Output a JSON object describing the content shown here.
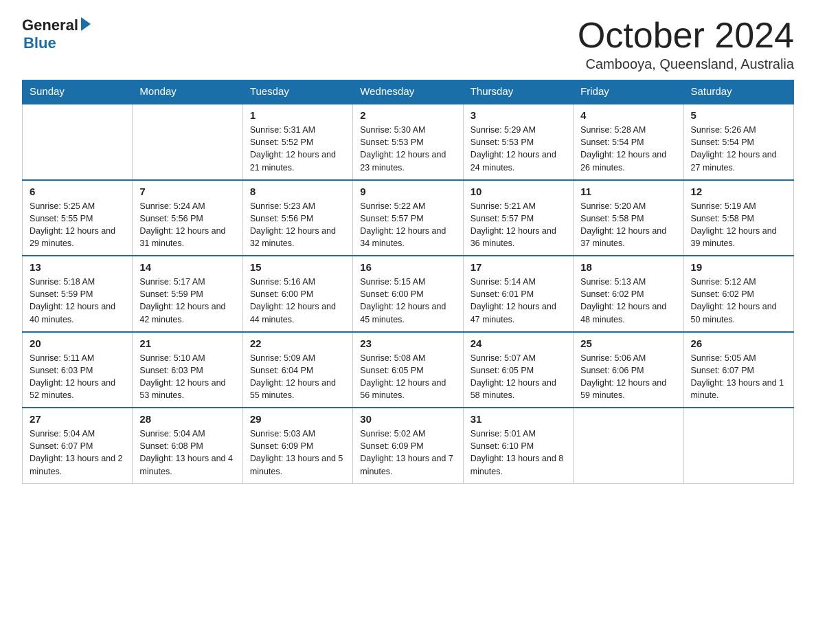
{
  "header": {
    "logo_general": "General",
    "logo_blue": "Blue",
    "title": "October 2024",
    "location": "Cambooya, Queensland, Australia"
  },
  "weekdays": [
    "Sunday",
    "Monday",
    "Tuesday",
    "Wednesday",
    "Thursday",
    "Friday",
    "Saturday"
  ],
  "weeks": [
    [
      null,
      null,
      {
        "day": 1,
        "sunrise": "5:31 AM",
        "sunset": "5:52 PM",
        "daylight": "12 hours and 21 minutes."
      },
      {
        "day": 2,
        "sunrise": "5:30 AM",
        "sunset": "5:53 PM",
        "daylight": "12 hours and 23 minutes."
      },
      {
        "day": 3,
        "sunrise": "5:29 AM",
        "sunset": "5:53 PM",
        "daylight": "12 hours and 24 minutes."
      },
      {
        "day": 4,
        "sunrise": "5:28 AM",
        "sunset": "5:54 PM",
        "daylight": "12 hours and 26 minutes."
      },
      {
        "day": 5,
        "sunrise": "5:26 AM",
        "sunset": "5:54 PM",
        "daylight": "12 hours and 27 minutes."
      }
    ],
    [
      {
        "day": 6,
        "sunrise": "5:25 AM",
        "sunset": "5:55 PM",
        "daylight": "12 hours and 29 minutes."
      },
      {
        "day": 7,
        "sunrise": "5:24 AM",
        "sunset": "5:56 PM",
        "daylight": "12 hours and 31 minutes."
      },
      {
        "day": 8,
        "sunrise": "5:23 AM",
        "sunset": "5:56 PM",
        "daylight": "12 hours and 32 minutes."
      },
      {
        "day": 9,
        "sunrise": "5:22 AM",
        "sunset": "5:57 PM",
        "daylight": "12 hours and 34 minutes."
      },
      {
        "day": 10,
        "sunrise": "5:21 AM",
        "sunset": "5:57 PM",
        "daylight": "12 hours and 36 minutes."
      },
      {
        "day": 11,
        "sunrise": "5:20 AM",
        "sunset": "5:58 PM",
        "daylight": "12 hours and 37 minutes."
      },
      {
        "day": 12,
        "sunrise": "5:19 AM",
        "sunset": "5:58 PM",
        "daylight": "12 hours and 39 minutes."
      }
    ],
    [
      {
        "day": 13,
        "sunrise": "5:18 AM",
        "sunset": "5:59 PM",
        "daylight": "12 hours and 40 minutes."
      },
      {
        "day": 14,
        "sunrise": "5:17 AM",
        "sunset": "5:59 PM",
        "daylight": "12 hours and 42 minutes."
      },
      {
        "day": 15,
        "sunrise": "5:16 AM",
        "sunset": "6:00 PM",
        "daylight": "12 hours and 44 minutes."
      },
      {
        "day": 16,
        "sunrise": "5:15 AM",
        "sunset": "6:00 PM",
        "daylight": "12 hours and 45 minutes."
      },
      {
        "day": 17,
        "sunrise": "5:14 AM",
        "sunset": "6:01 PM",
        "daylight": "12 hours and 47 minutes."
      },
      {
        "day": 18,
        "sunrise": "5:13 AM",
        "sunset": "6:02 PM",
        "daylight": "12 hours and 48 minutes."
      },
      {
        "day": 19,
        "sunrise": "5:12 AM",
        "sunset": "6:02 PM",
        "daylight": "12 hours and 50 minutes."
      }
    ],
    [
      {
        "day": 20,
        "sunrise": "5:11 AM",
        "sunset": "6:03 PM",
        "daylight": "12 hours and 52 minutes."
      },
      {
        "day": 21,
        "sunrise": "5:10 AM",
        "sunset": "6:03 PM",
        "daylight": "12 hours and 53 minutes."
      },
      {
        "day": 22,
        "sunrise": "5:09 AM",
        "sunset": "6:04 PM",
        "daylight": "12 hours and 55 minutes."
      },
      {
        "day": 23,
        "sunrise": "5:08 AM",
        "sunset": "6:05 PM",
        "daylight": "12 hours and 56 minutes."
      },
      {
        "day": 24,
        "sunrise": "5:07 AM",
        "sunset": "6:05 PM",
        "daylight": "12 hours and 58 minutes."
      },
      {
        "day": 25,
        "sunrise": "5:06 AM",
        "sunset": "6:06 PM",
        "daylight": "12 hours and 59 minutes."
      },
      {
        "day": 26,
        "sunrise": "5:05 AM",
        "sunset": "6:07 PM",
        "daylight": "13 hours and 1 minute."
      }
    ],
    [
      {
        "day": 27,
        "sunrise": "5:04 AM",
        "sunset": "6:07 PM",
        "daylight": "13 hours and 2 minutes."
      },
      {
        "day": 28,
        "sunrise": "5:04 AM",
        "sunset": "6:08 PM",
        "daylight": "13 hours and 4 minutes."
      },
      {
        "day": 29,
        "sunrise": "5:03 AM",
        "sunset": "6:09 PM",
        "daylight": "13 hours and 5 minutes."
      },
      {
        "day": 30,
        "sunrise": "5:02 AM",
        "sunset": "6:09 PM",
        "daylight": "13 hours and 7 minutes."
      },
      {
        "day": 31,
        "sunrise": "5:01 AM",
        "sunset": "6:10 PM",
        "daylight": "13 hours and 8 minutes."
      },
      null,
      null
    ]
  ]
}
